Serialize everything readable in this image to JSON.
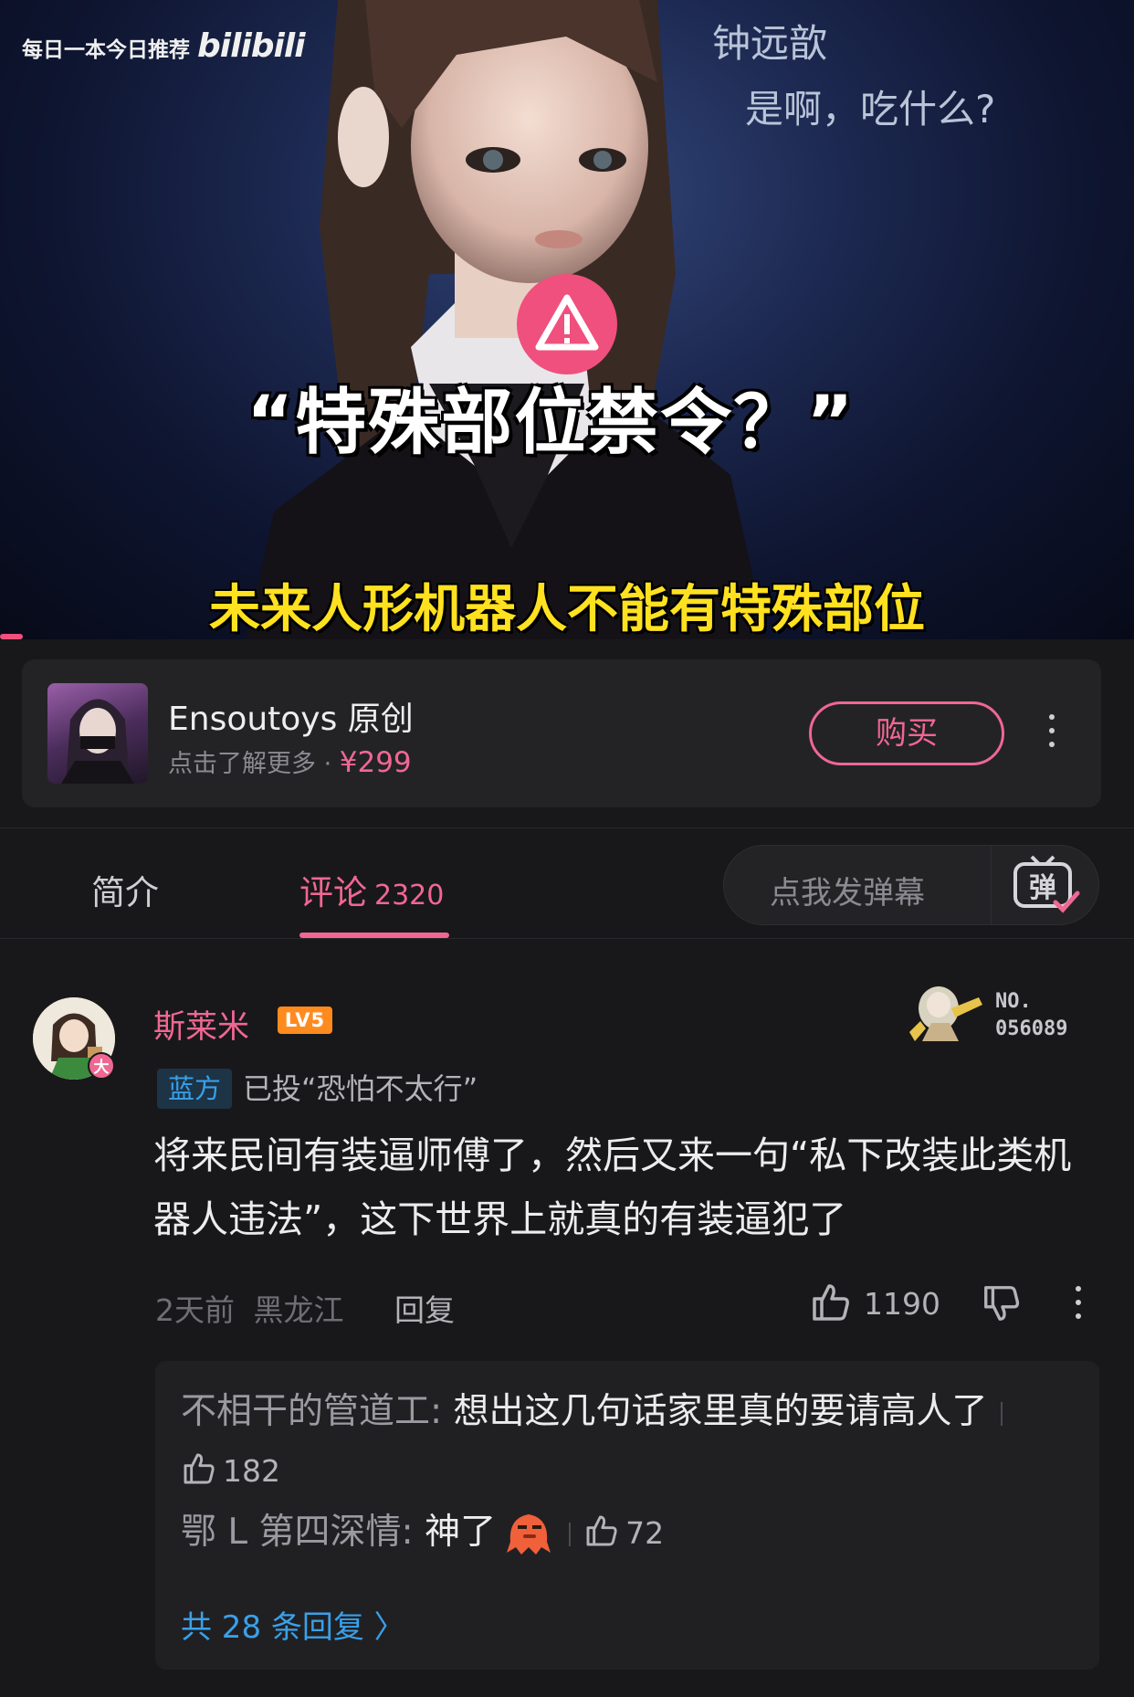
{
  "video": {
    "watermark_text": "每日一本今日推荐",
    "watermark_logo": "bilibili",
    "overlay_name": "钟远歆",
    "overlay_line": "是啊，吃什么?",
    "big_caption": "“特殊部位禁令？”",
    "sub_caption": "未来人形机器人不能有特殊部位",
    "progress_fraction": 0.02
  },
  "product": {
    "title": "Ensoutoys 原创",
    "subtitle": "点击了解更多 · ",
    "price": "¥299",
    "buy_label": "购买"
  },
  "tabs": {
    "intro_label": "简介",
    "comments_label": "评论",
    "comments_count": "2320",
    "danmaku_placeholder": "点我发弹幕",
    "danmaku_button_glyph": "弹"
  },
  "comment": {
    "avatar_badge": "大",
    "username": "斯莱米",
    "level": "LV5",
    "fan_number_prefix": "NO.",
    "fan_number": "056089",
    "vote_tag": "蓝方",
    "vote_text": "已投“恐怕不太行”",
    "text": "将来民间有装逼师傅了，然后又来一句“私下改装此类机器人违法”，这下世界上就真的有装逼犯了",
    "time": "2天前",
    "location": "黑龙江",
    "reply_label": "回复",
    "likes": "1190"
  },
  "replies": {
    "items": [
      {
        "name": "不相干的管道工:",
        "text": " 想出这几句话家里真的要请高人了",
        "likes": "182"
      },
      {
        "name": "鄂 L 第四深情:",
        "text": " 神了",
        "likes": "72"
      }
    ],
    "all_label": "共 28 条回复 〉"
  },
  "colors": {
    "accent_pink": "#f06792",
    "blue_link": "#3aa0e8",
    "background": "#18181a",
    "caption_yellow": "#ffe120"
  },
  "icons": [
    "warning-icon",
    "more-vertical-icon",
    "danmaku-icon",
    "like-icon",
    "dislike-icon",
    "emoji-sticker-icon",
    "chevron-right-icon"
  ]
}
